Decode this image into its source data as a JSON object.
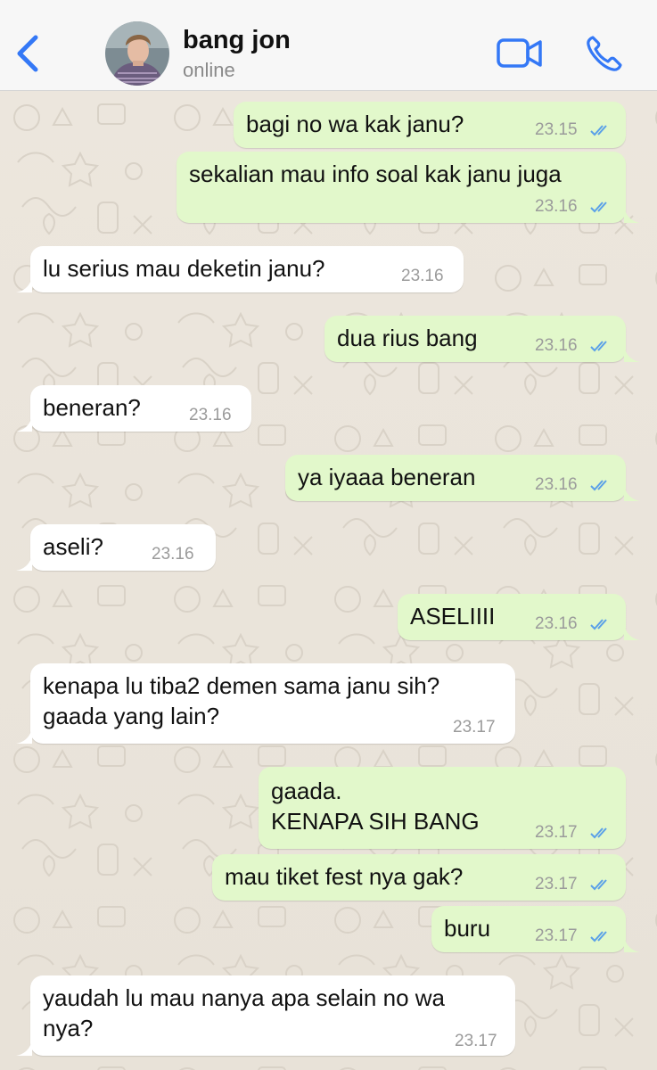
{
  "header": {
    "contact_name": "bang jon",
    "contact_status": "online"
  },
  "messages": [
    {
      "text": "bagi no wa kak janu?",
      "time": "23.15",
      "dir": "out"
    },
    {
      "text": "sekalian mau info soal kak janu juga",
      "time": "23.16",
      "dir": "out"
    },
    {
      "text": "lu serius mau deketin janu?",
      "time": "23.16",
      "dir": "in"
    },
    {
      "text": "dua rius bang",
      "time": "23.16",
      "dir": "out"
    },
    {
      "text": "beneran?",
      "time": "23.16",
      "dir": "in"
    },
    {
      "text": "ya iyaaa beneran",
      "time": "23.16",
      "dir": "out"
    },
    {
      "text": "aseli?",
      "time": "23.16",
      "dir": "in"
    },
    {
      "text": "ASELIIII",
      "time": "23.16",
      "dir": "out"
    },
    {
      "text": "kenapa lu tiba2 demen sama janu sih?\ngaada yang lain?",
      "time": "23.17",
      "dir": "in"
    },
    {
      "text": "gaada.\nKENAPA SIH BANG",
      "time": "23.17",
      "dir": "out"
    },
    {
      "text": "mau tiket fest nya gak?",
      "time": "23.17",
      "dir": "out"
    },
    {
      "text": "buru",
      "time": "23.17",
      "dir": "out"
    },
    {
      "text": "yaudah lu mau nanya apa selain no wa\nnya?",
      "time": "23.17",
      "dir": "in"
    }
  ],
  "colors": {
    "accent": "#3478f6",
    "outgoing_bubble": "#e2f8cb",
    "incoming_bubble": "#ffffff",
    "read_ticks": "#5aa0e8"
  },
  "icons": {
    "back": "chevron-left-icon",
    "video": "video-camera-icon",
    "call": "phone-icon",
    "read": "double-check-icon"
  }
}
